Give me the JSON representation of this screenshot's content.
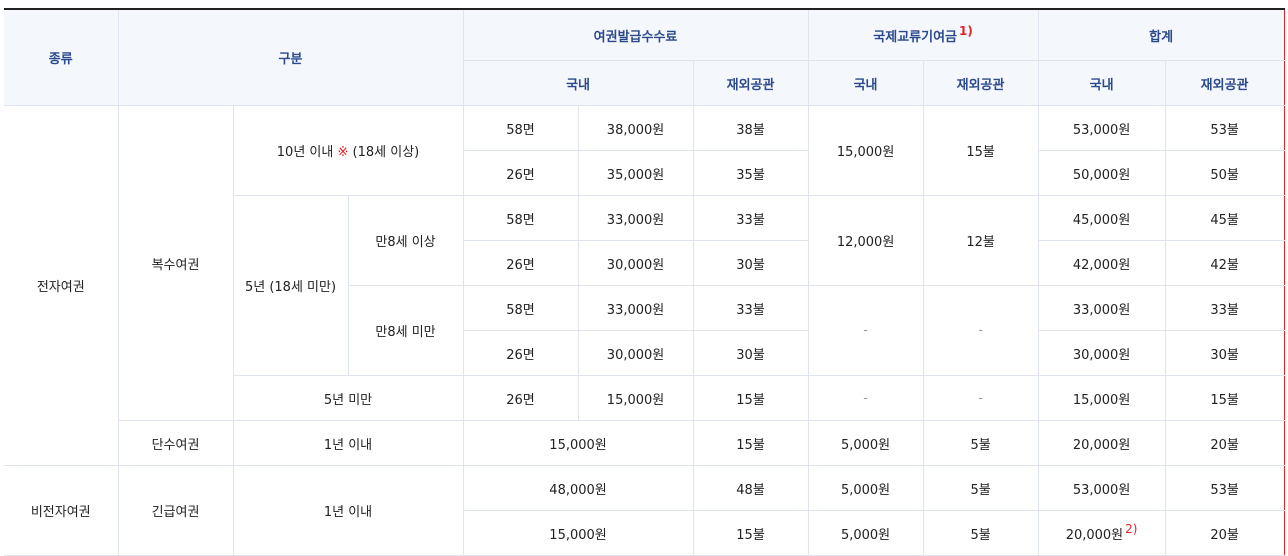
{
  "headers": {
    "type": "종류",
    "category": "구분",
    "passport_fee": "여권발급수수료",
    "intl_contribution": "국제교류기여금",
    "intl_note": "1)",
    "total": "합계",
    "domestic": "국내",
    "overseas": "재외공관"
  },
  "rows": {
    "electronic": "전자여권",
    "non_electronic": "비전자여권",
    "multiple": "복수여권",
    "single": "단수여권",
    "emergency": "긴급여권",
    "ten_years": "10년 이내",
    "ten_asterisk": "※",
    "ten_suffix": "(18세 이상)",
    "five_years": "5년 (18세 미만)",
    "age8_over": "만8세 이상",
    "age8_under": "만8세 미만",
    "under_five": "5년 미만",
    "within_1yr": "1년 이내",
    "within_1yr_b": "1년 이내"
  },
  "values": {
    "p58": "58면",
    "p26": "26면",
    "r1": [
      "58면",
      "38,000원",
      "38불",
      "15,000원",
      "15불",
      "53,000원",
      "53불"
    ],
    "r2": [
      "26면",
      "35,000원",
      "35불",
      "50,000원",
      "50불"
    ],
    "r3": [
      "58면",
      "33,000원",
      "33불",
      "12,000원",
      "12불",
      "45,000원",
      "45불"
    ],
    "r4": [
      "26면",
      "30,000원",
      "30불",
      "42,000원",
      "42불"
    ],
    "r5": [
      "58면",
      "33,000원",
      "33불",
      "-",
      "-",
      "33,000원",
      "33불"
    ],
    "r6": [
      "26면",
      "30,000원",
      "30불",
      "30,000원",
      "30불"
    ],
    "r7": [
      "26면",
      "15,000원",
      "15불",
      "-",
      "-",
      "15,000원",
      "15불"
    ],
    "r8": [
      "15,000원",
      "15불",
      "5,000원",
      "5불",
      "20,000원",
      "20불"
    ],
    "r9": [
      "48,000원",
      "48불",
      "5,000원",
      "5불",
      "53,000원",
      "53불"
    ],
    "r10": [
      "15,000원",
      "15불",
      "5,000원",
      "5불",
      "20,000원",
      "20불"
    ],
    "r10_note": "2)"
  }
}
